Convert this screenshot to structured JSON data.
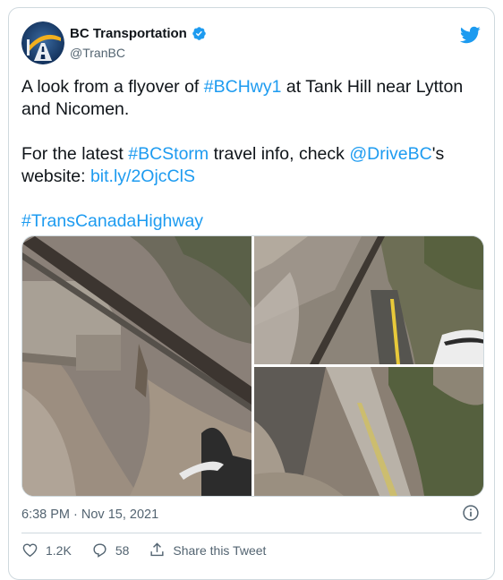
{
  "author": {
    "display_name": "BC Transportation",
    "handle": "@TranBC"
  },
  "tweet": {
    "line1_pre": "A look from a flyover of ",
    "line1_tag": "#BCHwy1",
    "line1_post": " at Tank Hill near Lytton",
    "line2": "and Nicomen.",
    "line3_pre": "For the latest ",
    "line3_tag": "#BCStorm",
    "line3_mid": " travel info, check ",
    "line3_mention": "@DriveBC",
    "line3_post": "'s",
    "line4_pre": "website: ",
    "line4_link": "bit.ly/2OjcClS",
    "line5_tag": "#TransCanadaHighway"
  },
  "timestamp": "6:38 PM · Nov 15, 2021",
  "actions": {
    "likes": "1.2K",
    "replies": "58",
    "share_label": "Share this Tweet"
  },
  "colors": {
    "link": "#1d9bf0",
    "secondary_text": "#536471",
    "border": "#cfd9de"
  },
  "icons": [
    "verified-badge-icon",
    "twitter-bird-icon",
    "info-icon",
    "heart-icon",
    "reply-icon",
    "share-icon"
  ]
}
